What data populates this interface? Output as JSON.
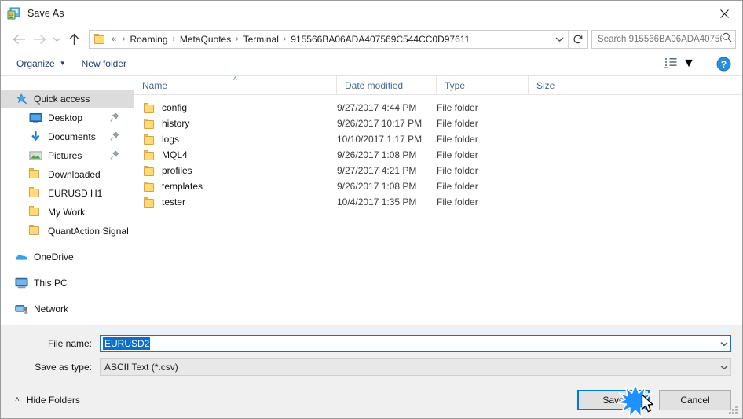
{
  "window": {
    "title": "Save As",
    "title_icon": "save-as-app-icon",
    "close_label": "✕"
  },
  "nav": {
    "back_icon": "arrow-left-icon",
    "forward_icon": "arrow-right-icon",
    "recent_icon": "chevron-down-icon",
    "up_icon": "arrow-up-icon",
    "refresh_icon": "refresh-icon",
    "address": {
      "folder_icon": "folder-icon",
      "overflow": "«",
      "separator": "›",
      "crumbs": [
        "Roaming",
        "MetaQuotes",
        "Terminal",
        "915566BA06ADA407569C544CC0D97611"
      ],
      "dropdown_icon": "chevron-down-icon"
    },
    "search": {
      "placeholder": "Search 915566BA06ADA40756...",
      "icon": "search-icon"
    }
  },
  "toolbar": {
    "organize_label": "Organize",
    "organize_caret": "▼",
    "new_folder_label": "New folder",
    "view_icon": "list-view-icon",
    "view_caret": "▼",
    "help_icon": "help-icon",
    "help_label": "?"
  },
  "sidebar": {
    "items": [
      {
        "label": "Quick access",
        "icon": "star-pin-icon",
        "level": "root",
        "selected": true,
        "pinned": false
      },
      {
        "label": "Desktop",
        "icon": "desktop-icon",
        "level": "child",
        "selected": false,
        "pinned": true
      },
      {
        "label": "Documents",
        "icon": "documents-down-arrow-icon",
        "level": "child",
        "selected": false,
        "pinned": true
      },
      {
        "label": "Pictures",
        "icon": "pictures-icon",
        "level": "child",
        "selected": false,
        "pinned": true
      },
      {
        "label": "Downloaded",
        "icon": "folder-icon",
        "level": "child",
        "selected": false,
        "pinned": false
      },
      {
        "label": "EURUSD H1",
        "icon": "folder-icon",
        "level": "child",
        "selected": false,
        "pinned": false
      },
      {
        "label": "My Work",
        "icon": "folder-icon",
        "level": "child",
        "selected": false,
        "pinned": false
      },
      {
        "label": "QuantAction Signal",
        "icon": "folder-icon",
        "level": "child",
        "selected": false,
        "pinned": false
      },
      {
        "label": "OneDrive",
        "icon": "onedrive-cloud-icon",
        "level": "root",
        "selected": false,
        "pinned": false
      },
      {
        "label": "This PC",
        "icon": "this-pc-icon",
        "level": "root",
        "selected": false,
        "pinned": false
      },
      {
        "label": "Network",
        "icon": "network-icon",
        "level": "root",
        "selected": false,
        "pinned": false
      }
    ]
  },
  "filelist": {
    "columns": [
      {
        "label": "Name",
        "sorted": "asc"
      },
      {
        "label": "Date modified",
        "sorted": ""
      },
      {
        "label": "Type",
        "sorted": ""
      },
      {
        "label": "Size",
        "sorted": ""
      }
    ],
    "sort_caret": "˄",
    "rows": [
      {
        "name": "config",
        "date": "9/27/2017 4:44 PM",
        "type": "File folder",
        "size": "",
        "icon": "folder-icon"
      },
      {
        "name": "history",
        "date": "9/26/2017 10:17 PM",
        "type": "File folder",
        "size": "",
        "icon": "folder-icon"
      },
      {
        "name": "logs",
        "date": "10/10/2017 1:17 PM",
        "type": "File folder",
        "size": "",
        "icon": "folder-icon"
      },
      {
        "name": "MQL4",
        "date": "9/26/2017 1:08 PM",
        "type": "File folder",
        "size": "",
        "icon": "folder-icon"
      },
      {
        "name": "profiles",
        "date": "9/27/2017 4:21 PM",
        "type": "File folder",
        "size": "",
        "icon": "folder-icon"
      },
      {
        "name": "templates",
        "date": "9/26/2017 1:08 PM",
        "type": "File folder",
        "size": "",
        "icon": "folder-icon"
      },
      {
        "name": "tester",
        "date": "10/4/2017 1:35 PM",
        "type": "File folder",
        "size": "",
        "icon": "folder-icon"
      }
    ]
  },
  "form": {
    "filename_label": "File name:",
    "filename_value": "EURUSD2",
    "filename_selected": true,
    "filetype_label": "Save as type:",
    "filetype_value": "ASCII Text (*.csv)",
    "dropdown_icon": "chevron-down-icon"
  },
  "footer": {
    "hide_folders_label": "Hide Folders",
    "hide_folders_caret": "˄",
    "save_label": "Save",
    "cancel_label": "Cancel",
    "resize_grip_icon": "resize-grip-icon",
    "cursor_icon": "mouse-pointer-icon",
    "click_burst_icon": "click-burst-icon"
  },
  "colors": {
    "accent": "#0078d7",
    "selection": "#0b6ec9",
    "folder": "#ffd97a",
    "header_text": "#46678f",
    "window_bg": "#f0f0f0"
  }
}
